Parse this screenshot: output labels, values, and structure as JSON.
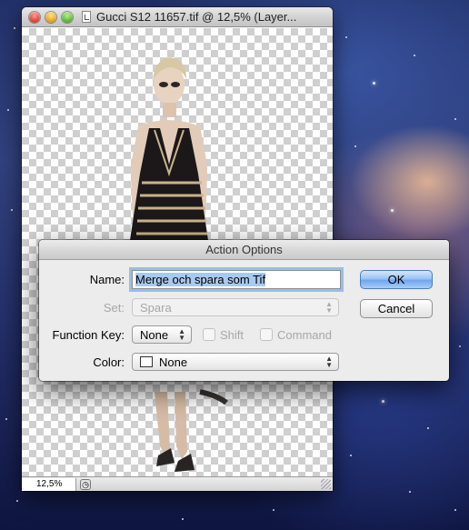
{
  "window": {
    "title": "Gucci S12 11657.tif @ 12,5% (Layer...",
    "zoom": "12,5%"
  },
  "dialog": {
    "title": "Action Options",
    "name_label": "Name:",
    "name_value": "Merge och spara som Tif",
    "set_label": "Set:",
    "set_value": "Spara",
    "function_key_label": "Function Key:",
    "function_key_value": "None",
    "shift_label": "Shift",
    "command_label": "Command",
    "color_label": "Color:",
    "color_value": "None",
    "ok_label": "OK",
    "cancel_label": "Cancel"
  },
  "colors": {
    "accent": "#6fa5ee",
    "dialog_bg": "#ececec"
  }
}
